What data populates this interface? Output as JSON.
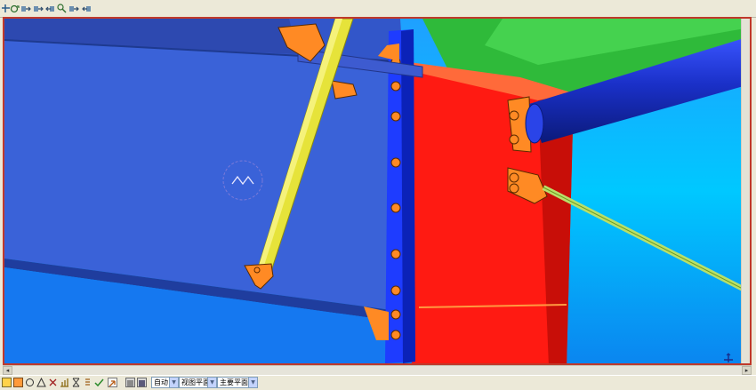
{
  "toolbar": {
    "icons": [
      "pan-icon",
      "rotate-icon",
      "snap-icon",
      "zoom-in-icon",
      "zoom-out-icon",
      "zoom-window-icon",
      "fit-view-icon"
    ]
  },
  "statusbar": {
    "icons": [
      "snap-end-icon",
      "snap-mid-icon",
      "snap-circle-icon",
      "snap-perp-icon",
      "snap-cross-icon",
      "snap-grid-icon",
      "snap-line-icon",
      "snap-plane-icon",
      "snap-free-icon",
      "check-icon",
      "select-arrow-icon",
      "model-icon",
      "view-icon"
    ],
    "combo_snap": "自动",
    "combo_view_plane": "视图平面",
    "combo_main_plane": "主要平面"
  },
  "colors": {
    "background": "#00c8ff",
    "beam_blue": "#3a62d8",
    "column_red": "#ff1a12",
    "beam_green": "#2fba3a",
    "brace_yellow": "#e6e33a",
    "plate_orange": "#ff8a24",
    "frame_border": "#c0392b"
  }
}
